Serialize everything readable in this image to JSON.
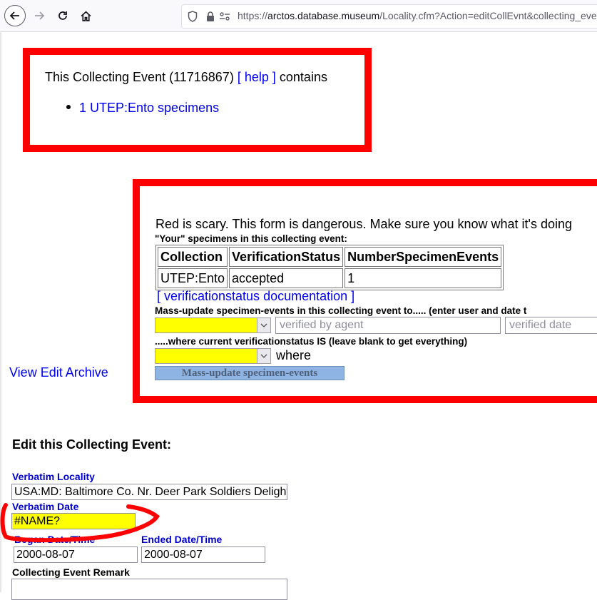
{
  "browser": {
    "url_prefix": "https://",
    "url_host": "arctos.database.museum",
    "url_path": "/Locality.cfm?Action=editCollEvnt&collecting_even"
  },
  "summary": {
    "text_before": "This Collecting Event (11716867)",
    "help_link": "[ help ]",
    "text_after": "contains",
    "item_link": "1 UTEP:Ento specimens"
  },
  "verification": {
    "warning": "Red is scary. This form is dangerous. Make sure you know what it's doing",
    "your_specimens_label": "\"Your\" specimens in this collecting event:",
    "table": {
      "headers": [
        "Collection",
        "VerificationStatus",
        "NumberSpecimenEvents"
      ],
      "rows": [
        [
          "UTEP:Ento",
          "accepted",
          "1"
        ]
      ]
    },
    "doc_link": "[ verificationstatus documentation ]",
    "mass_update_label": "Mass-update specimen-events in this collecting event to..... (enter user and date t",
    "verified_by_placeholder": "verified by agent",
    "verified_date_placeholder": "verified date",
    "where_current_label": ".....where current verificationstatus IS (leave blank to get everything)",
    "where_text": "where",
    "mass_update_button": "Mass-update specimen-events"
  },
  "view_edit_archive": "View Edit Archive",
  "edit_form": {
    "title": "Edit this Collecting Event:",
    "verbatim_locality_label": "Verbatim Locality",
    "verbatim_locality_value": "USA:MD: Baltimore Co. Nr. Deer Park Soldiers Delight",
    "verbatim_date_label": "Verbatim Date",
    "verbatim_date_value": "#NAME?",
    "began_label": "Began Date/Time",
    "began_value": "2000-08-07",
    "ended_label": "Ended Date/Time",
    "ended_value": "2000-08-07",
    "remark_label": "Collecting Event Remark"
  },
  "colors": {
    "annotation": "#ff0000",
    "highlight": "#ffff00",
    "link": "#0000ee"
  }
}
